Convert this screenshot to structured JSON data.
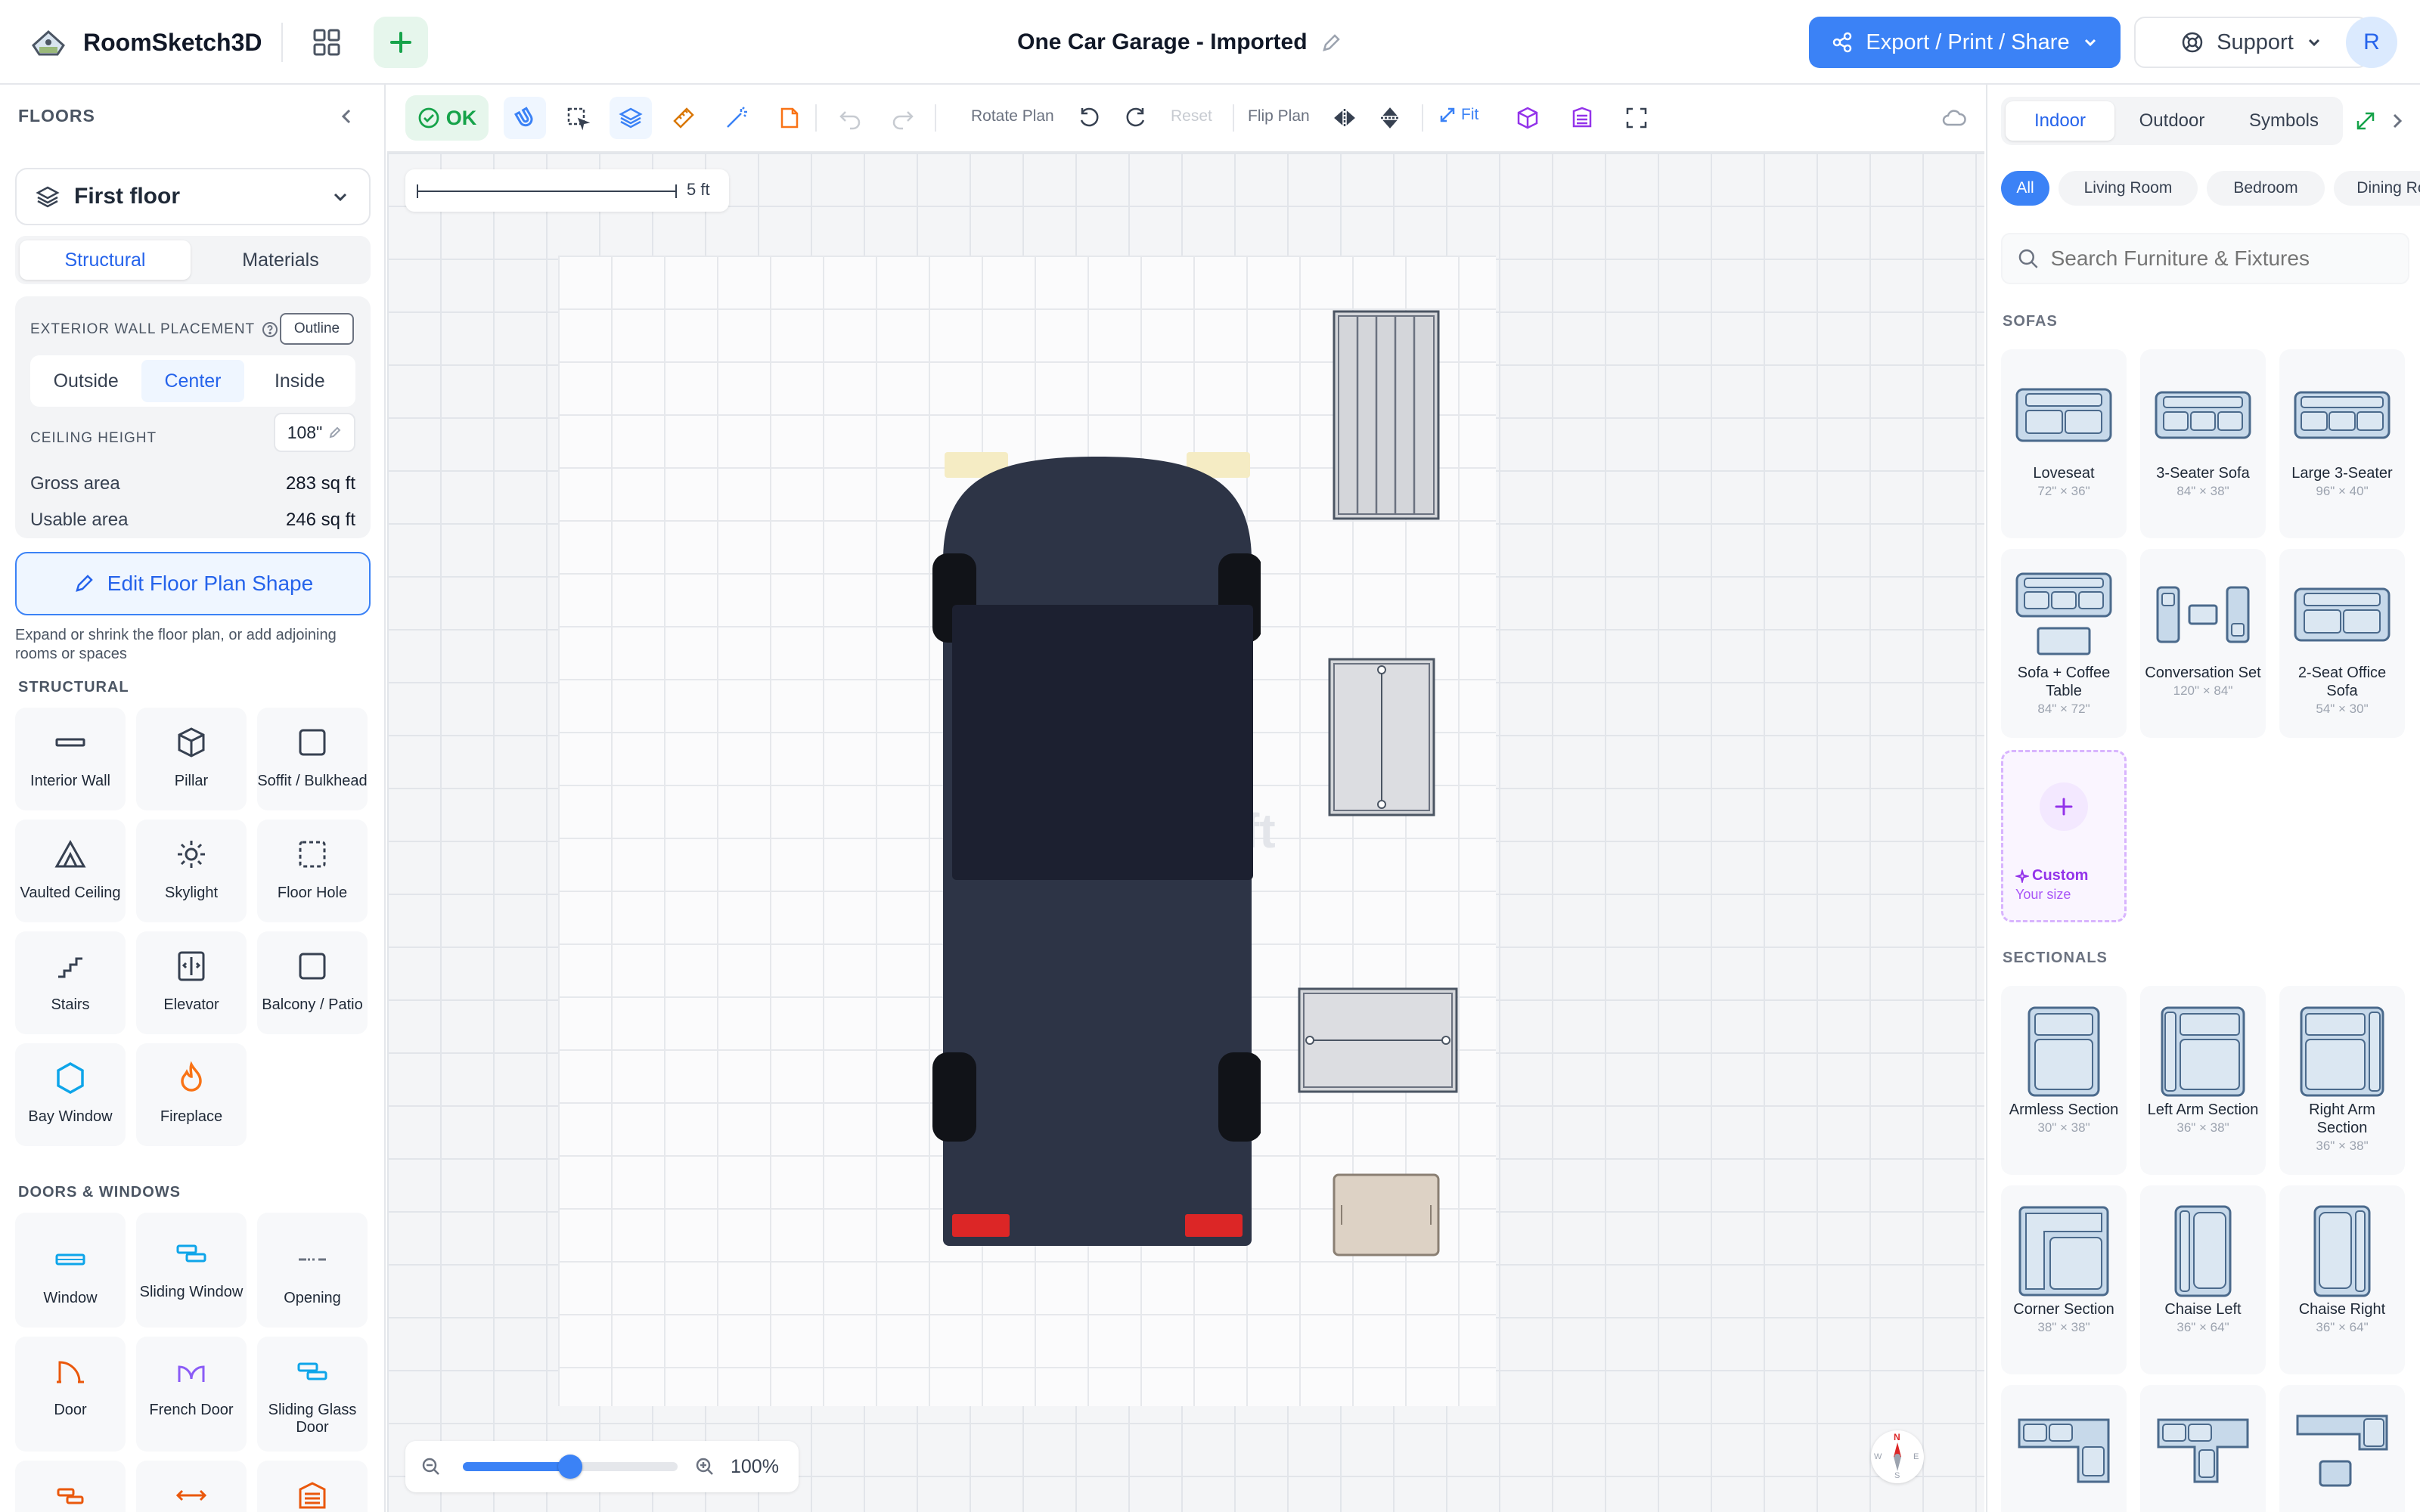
{
  "app": {
    "name": "RoomSketch3D",
    "avatar_initial": "R"
  },
  "header": {
    "project_title": "One Car Garage - Imported",
    "export_label": "Export / Print / Share",
    "support_label": "Support"
  },
  "left_panel": {
    "heading": "FLOORS",
    "floor_selected": "First floor",
    "tabs": [
      "Structural",
      "Materials"
    ],
    "wall_placement_label": "EXTERIOR WALL PLACEMENT",
    "outline_label": "Outline",
    "wall_options": [
      "Outside",
      "Center",
      "Inside"
    ],
    "ceiling_label": "CEILING HEIGHT",
    "ceiling_value": "108\"",
    "gross_label": "Gross area",
    "gross_value": "283 sq ft",
    "usable_label": "Usable area",
    "usable_value": "246 sq ft",
    "edit_button": "Edit Floor Plan Shape",
    "edit_help": "Expand or shrink the floor plan, or add adjoining rooms or spaces",
    "structural_heading": "STRUCTURAL",
    "structural_items": [
      "Interior Wall",
      "Pillar",
      "Soffit / Bulkhead",
      "Vaulted Ceiling",
      "Skylight",
      "Floor Hole",
      "Stairs",
      "Elevator",
      "Balcony / Patio",
      "Bay Window",
      "Fireplace"
    ],
    "doors_heading": "DOORS & WINDOWS",
    "door_items": [
      "Window",
      "Sliding Window",
      "Opening",
      "Door",
      "French Door",
      "Sliding Glass Door"
    ]
  },
  "toolbar": {
    "ok_label": "OK",
    "rotate_label": "Rotate Plan",
    "reset_label": "Reset",
    "flip_label": "Flip Plan",
    "fit_label": "Fit"
  },
  "canvas": {
    "scale_label": "5 ft",
    "watermark": "ft",
    "zoom_percent": 100,
    "zoom_label": "100%",
    "compass": {
      "n": "N",
      "s": "S",
      "e": "E",
      "w": "W"
    }
  },
  "colors": {
    "accent": "#3b82f6",
    "car_body": "#2d3446",
    "car_glass": "#1c2030",
    "headlight": "#f5ecc4",
    "taillight": "#dc2626",
    "custom_purple": "#9333ea"
  },
  "right_panel": {
    "tabs": [
      "Indoor",
      "Outdoor",
      "Symbols"
    ],
    "chips": [
      "All",
      "Living Room",
      "Bedroom",
      "Dining Room"
    ],
    "search_placeholder": "Search Furniture & Fixtures",
    "sofas_heading": "SOFAS",
    "sofas": [
      {
        "name": "Loveseat",
        "dims": "72\" × 36\""
      },
      {
        "name": "3-Seater Sofa",
        "dims": "84\" × 38\""
      },
      {
        "name": "Large 3-Seater",
        "dims": "96\" × 40\""
      },
      {
        "name": "Sofa + Coffee Table",
        "dims": "84\" × 72\""
      },
      {
        "name": "Conversation Set",
        "dims": "120\" × 84\""
      },
      {
        "name": "2-Seat Office Sofa",
        "dims": "54\" × 30\""
      }
    ],
    "custom": {
      "label": "Custom",
      "sub": "Your size"
    },
    "sectionals_heading": "SECTIONALS",
    "sectionals": [
      {
        "name": "Armless Section",
        "dims": "30\" × 38\""
      },
      {
        "name": "Left Arm Section",
        "dims": "36\" × 38\""
      },
      {
        "name": "Right Arm Section",
        "dims": "36\" × 38\""
      },
      {
        "name": "Corner Section",
        "dims": "38\" × 38\""
      },
      {
        "name": "Chaise Left",
        "dims": "36\" × 64\""
      },
      {
        "name": "Chaise Right",
        "dims": "36\" × 64\""
      }
    ]
  }
}
